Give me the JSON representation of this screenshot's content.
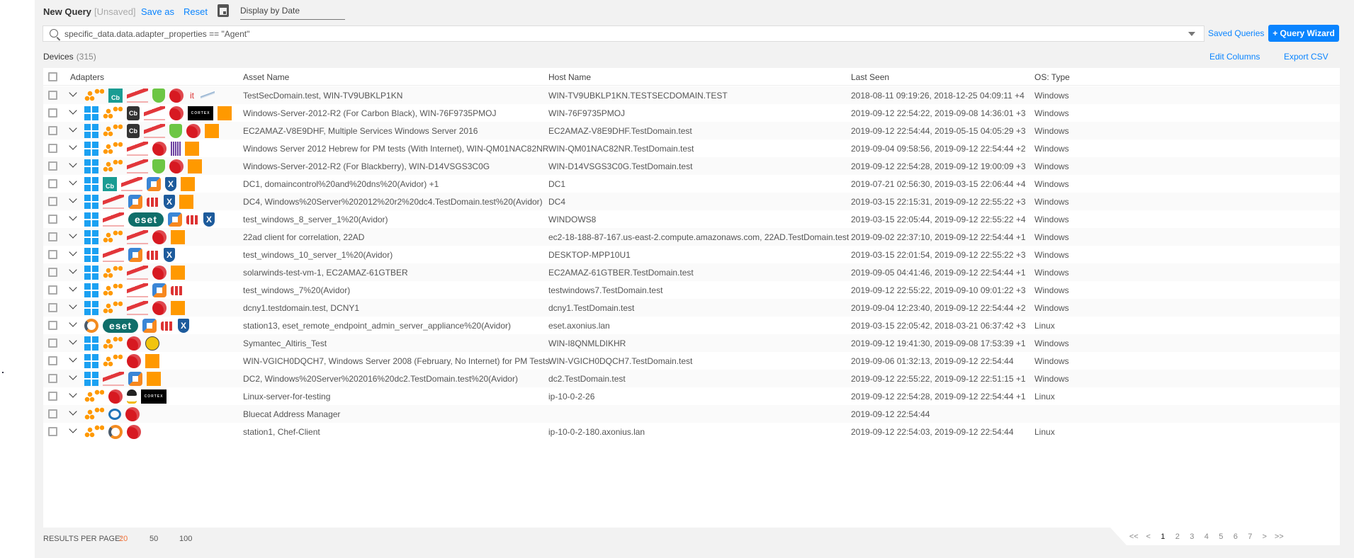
{
  "header": {
    "title": "New Query",
    "status": "[Unsaved]",
    "save_as": "Save as",
    "reset": "Reset",
    "date_placeholder": "Display by Date"
  },
  "search": {
    "value": "specific_data.data.adapter_properties == \"Agent\"",
    "saved_queries": "Saved Queries",
    "wizard": "+ Query Wizard"
  },
  "devices": {
    "label": "Devices",
    "count": "(315)",
    "edit_columns": "Edit Columns",
    "export_csv": "Export CSV"
  },
  "columns": [
    "Adapters",
    "Asset Name",
    "Host Name",
    "Last Seen",
    "OS: Type"
  ],
  "logo_text": {
    "cb": "Cb",
    "cortex": "CORTEX",
    "eset": "eset",
    "it": "it",
    "xshield": "X"
  },
  "colors": {
    "accent": "#0a84ff",
    "selected_page_size": "#f4733a",
    "background": "#f2f2f2"
  },
  "rows": [
    {
      "adapters": [
        "aws",
        "cb-teal",
        "crowdstrike",
        "cylance",
        "trend",
        "it",
        "sql"
      ],
      "asset": "TestSecDomain.test, WIN-TV9UBKLP1KN",
      "host": "WIN-TV9UBKLP1KN.TESTSECDOMAIN.TEST",
      "seen": "2018-08-11 09:19:26, 2018-12-25 04:09:11 +4",
      "os": "Windows"
    },
    {
      "adapters": [
        "windows",
        "aws",
        "cb-dark",
        "crowdstrike",
        "trend",
        "cortex",
        "solarwinds"
      ],
      "asset": "Windows-Server-2012-R2 (For Carbon Black), WIN-76F9735PMOJ",
      "host": "WIN-76F9735PMOJ",
      "seen": "2019-09-12 22:54:22, 2019-09-08 14:36:01 +3",
      "os": "Windows"
    },
    {
      "adapters": [
        "windows",
        "aws",
        "cb-dark",
        "crowdstrike",
        "cylance",
        "trend",
        "solarwinds"
      ],
      "asset": "EC2AMAZ-V8E9DHF, Multiple Services Windows Server 2016",
      "host": "EC2AMAZ-V8E9DHF.TestDomain.test",
      "seen": "2019-09-12 22:54:44, 2019-05-15 04:05:29 +3",
      "os": "Windows"
    },
    {
      "adapters": [
        "windows",
        "aws",
        "crowdstrike",
        "trend",
        "purple",
        "solarwinds"
      ],
      "asset": "Windows Server 2012 Hebrew for PM tests (With Internet), WIN-QM01NAC82NR",
      "host": "WIN-QM01NAC82NR.TestDomain.test",
      "seen": "2019-09-04 09:58:56, 2019-09-12 22:54:44 +2",
      "os": "Windows"
    },
    {
      "adapters": [
        "windows",
        "aws",
        "crowdstrike",
        "cylance",
        "trend",
        "solarwinds"
      ],
      "asset": "Windows-Server-2012-R2 (For Blackberry), WIN-D14VSGS3C0G",
      "host": "WIN-D14VSGS3C0G.TestDomain.test",
      "seen": "2019-09-12 22:54:28, 2019-09-12 19:00:09 +3",
      "os": "Windows"
    },
    {
      "adapters": [
        "windows",
        "cb-teal",
        "crowdstrike",
        "vmware",
        "xshield",
        "solarwinds"
      ],
      "asset": "DC1, domaincontrol%20and%20dns%20(Avidor) +1",
      "host": "DC1",
      "seen": "2019-07-21 02:56:30, 2019-03-15 22:06:44 +4",
      "os": "Windows"
    },
    {
      "adapters": [
        "windows",
        "crowdstrike",
        "vmware",
        "fortinet",
        "xshield",
        "solarwinds"
      ],
      "asset": "DC4, Windows%20Server%202012%20r2%20dc4.TestDomain.test%20(Avidor)",
      "host": "DC4",
      "seen": "2019-03-15 22:15:31, 2019-09-12 22:55:22 +3",
      "os": "Windows"
    },
    {
      "adapters": [
        "windows",
        "crowdstrike",
        "eset",
        "vmware",
        "fortinet",
        "xshield"
      ],
      "asset": "test_windows_8_server_1%20(Avidor)",
      "host": "WINDOWS8",
      "seen": "2019-03-15 22:05:44, 2019-09-12 22:55:22 +4",
      "os": "Windows"
    },
    {
      "adapters": [
        "windows",
        "aws",
        "crowdstrike",
        "trend",
        "solarwinds"
      ],
      "asset": "22ad client for correlation, 22AD",
      "host": "ec2-18-188-87-167.us-east-2.compute.amazonaws.com, 22AD.TestDomain.test",
      "seen": "2019-09-02 22:37:10, 2019-09-12 22:54:44 +1",
      "os": "Windows"
    },
    {
      "adapters": [
        "windows",
        "crowdstrike",
        "vmware",
        "fortinet",
        "xshield"
      ],
      "asset": "test_windows_10_server_1%20(Avidor)",
      "host": "DESKTOP-MPP10U1",
      "seen": "2019-03-15 22:01:54, 2019-09-12 22:55:22 +3",
      "os": "Windows"
    },
    {
      "adapters": [
        "windows",
        "aws",
        "crowdstrike",
        "trend",
        "solarwinds"
      ],
      "asset": "solarwinds-test-vm-1, EC2AMAZ-61GTBER",
      "host": "EC2AMAZ-61GTBER.TestDomain.test",
      "seen": "2019-09-05 04:41:46, 2019-09-12 22:54:44 +1",
      "os": "Windows"
    },
    {
      "adapters": [
        "windows",
        "aws",
        "crowdstrike",
        "vmware",
        "fortinet"
      ],
      "asset": "test_windows_7%20(Avidor)",
      "host": "testwindows7.TestDomain.test",
      "seen": "2019-09-12 22:55:22, 2019-09-10 09:01:22 +3",
      "os": "Windows"
    },
    {
      "adapters": [
        "windows",
        "aws",
        "crowdstrike",
        "trend",
        "solarwinds"
      ],
      "asset": "dcny1.testdomain.test, DCNY1",
      "host": "dcny1.TestDomain.test",
      "seen": "2019-09-04 12:23:40, 2019-09-12 22:54:44 +2",
      "os": "Windows"
    },
    {
      "adapters": [
        "chef",
        "eset",
        "vmware",
        "fortinet",
        "xshield"
      ],
      "asset": "station13, eset_remote_endpoint_admin_server_appliance%20(Avidor)",
      "host": "eset.axonius.lan",
      "seen": "2019-03-15 22:05:42, 2018-03-21 06:37:42 +3",
      "os": "Linux"
    },
    {
      "adapters": [
        "windows",
        "aws",
        "trend",
        "altiris"
      ],
      "asset": "Symantec_Altiris_Test",
      "host": "WIN-I8QNMLDIKHR",
      "seen": "2019-09-12 19:41:30, 2019-09-08 17:53:39 +1",
      "os": "Windows"
    },
    {
      "adapters": [
        "windows",
        "aws",
        "trend",
        "solarwinds"
      ],
      "asset": "WIN-VGICH0DQCH7, Windows Server 2008 (February, No Internet) for PM Tests",
      "host": "WIN-VGICH0DQCH7.TestDomain.test",
      "seen": "2019-09-06 01:32:13, 2019-09-12 22:54:44",
      "os": "Windows"
    },
    {
      "adapters": [
        "windows",
        "crowdstrike",
        "vmware",
        "solarwinds"
      ],
      "asset": "DC2, Windows%20Server%202016%20dc2.TestDomain.test%20(Avidor)",
      "host": "dc2.TestDomain.test",
      "seen": "2019-09-12 22:55:22, 2019-09-12 22:51:15 +1",
      "os": "Windows"
    },
    {
      "adapters": [
        "aws",
        "trend",
        "linux",
        "cortex"
      ],
      "asset": "Linux-server-for-testing",
      "host": "ip-10-0-2-26",
      "seen": "2019-09-12 22:54:28, 2019-09-12 22:54:44 +1",
      "os": "Linux"
    },
    {
      "adapters": [
        "aws",
        "bluecat",
        "trend"
      ],
      "asset": "Bluecat Address Manager",
      "host": "",
      "seen": "2019-09-12 22:54:44",
      "os": ""
    },
    {
      "adapters": [
        "aws",
        "chef",
        "trend"
      ],
      "asset": "station1, Chef-Client",
      "host": "ip-10-0-2-180.axonius.lan",
      "seen": "2019-09-12 22:54:03, 2019-09-12 22:54:44",
      "os": "Linux"
    }
  ],
  "footer": {
    "results_label": "RESULTS PER PAGE:",
    "page_sizes": [
      "20",
      "50",
      "100"
    ],
    "selected_size": "20",
    "pager": [
      "<<",
      "<",
      "1",
      "2",
      "3",
      "4",
      "5",
      "6",
      "7",
      ">",
      ">>"
    ],
    "current_page": "1"
  }
}
